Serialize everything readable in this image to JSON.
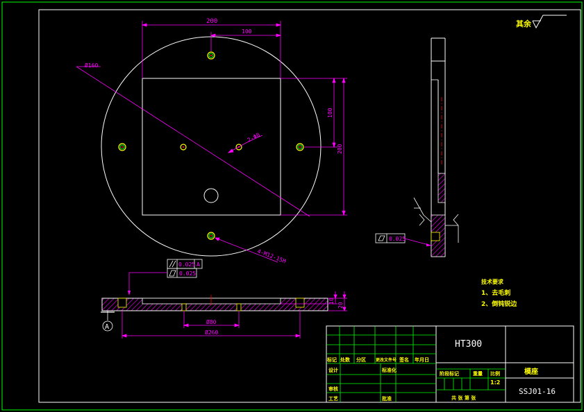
{
  "colors": {
    "background": "#000000",
    "frame": "#00ff00",
    "outline": "#ffffff",
    "dimension": "#ff00ff",
    "hole": "#ffff00",
    "hole_center": "#ff0000",
    "note": "#ffff00"
  },
  "dimensions": {
    "width_200": "200",
    "half_100": "100",
    "dia_160": "Ø160",
    "height_100": "100",
    "height_200": "200",
    "holes_2_phi8": "2-Φ8",
    "thread_holes": "4-M12-15H",
    "dia_80": "Ø80",
    "dia_260": "Ø260",
    "thickness_10": "10",
    "thickness_20": "20"
  },
  "tolerances": {
    "parallelism_value": "0.025",
    "parallelism_datum": "A",
    "flatness_value_main": "0.025",
    "flatness_value_side": "0.025"
  },
  "datum_label": "A",
  "roughness_label": "其余",
  "notes": {
    "title": "技术要求",
    "item1": "1、去毛刺",
    "item2": "2、倒钝锐边"
  },
  "title_block": {
    "material": "HT300",
    "part_name": "模座",
    "drawing_number": "SSJ01-16",
    "scale": "1:2",
    "header_cells": [
      "标记",
      "处数",
      "分区",
      "更改文件号",
      "签名",
      "年月日"
    ],
    "label_design": "设计",
    "label_standardize": "标准化",
    "label_check": "审核",
    "label_process": "工艺",
    "label_approve": "批准",
    "label_stage_mark": "阶段标记",
    "label_weight": "重量",
    "label_scale": "比例",
    "sheet_info": "共 张 第 张"
  }
}
